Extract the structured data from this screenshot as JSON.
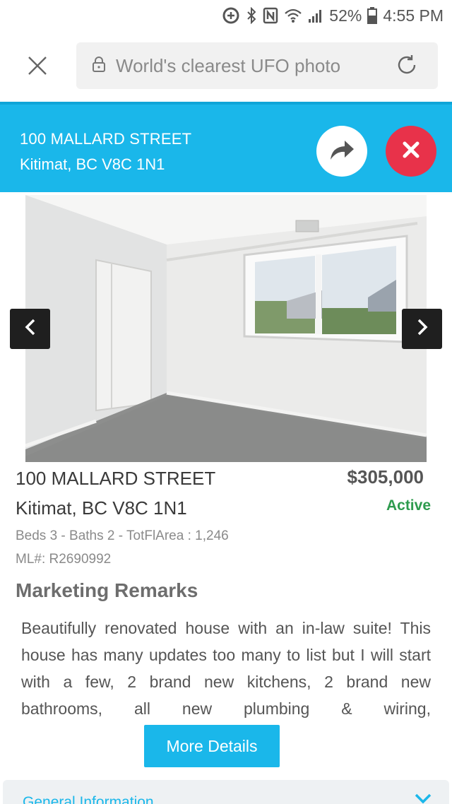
{
  "status_bar": {
    "battery": "52%",
    "time": "4:55 PM",
    "icons": [
      "data-saver-icon",
      "bluetooth-icon",
      "nfc-icon",
      "wifi-icon",
      "signal-icon",
      "battery-icon"
    ]
  },
  "browser": {
    "url_text": "World's clearest UFO photo",
    "icons": [
      "close-icon",
      "lock-icon",
      "reload-icon"
    ]
  },
  "banner": {
    "street": "100 MALLARD STREET",
    "city": "Kitimat, BC V8C 1N1",
    "share_icon": "share-arrow-icon",
    "close_icon": "close-icon",
    "accent_color": "#1ab7ea",
    "close_color": "#e8324a"
  },
  "listing": {
    "street": "100 MALLARD STREET",
    "city": "Kitimat, BC V8C 1N1",
    "price": "$305,000",
    "status": "Active",
    "status_color": "#2e9b4e",
    "specs": "Beds 3 - Baths 2 - TotFlArea : 1,246",
    "mls": "ML#: R2690992"
  },
  "remarks": {
    "title": "Marketing Remarks",
    "text": "Beautifully renovated house with an in-law suite! This house has many updates too many to list but I will start with a few, 2 brand new kitchens, 2 brand new bathrooms, all new plumbing & wiring,"
  },
  "actions": {
    "more_details": "More Details"
  },
  "general": {
    "label": "General Information"
  }
}
